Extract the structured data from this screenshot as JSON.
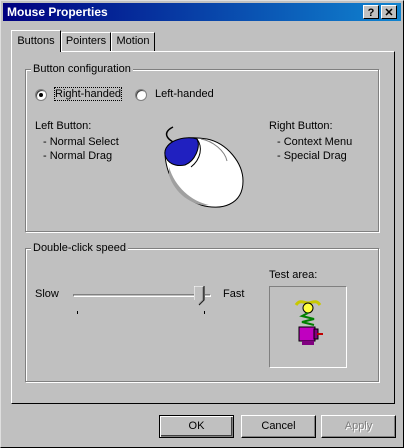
{
  "window": {
    "title": "Mouse Properties",
    "help_glyph": "?",
    "close_glyph": "✕"
  },
  "tabs": [
    {
      "label": "Buttons"
    },
    {
      "label": "Pointers"
    },
    {
      "label": "Motion"
    }
  ],
  "button_configuration": {
    "title": "Button configuration",
    "right_handed": "Right-handed",
    "left_handed": "Left-handed",
    "selected": "Right-handed",
    "left_button": {
      "title": "Left Button:",
      "items": [
        "-  Normal Select",
        "-  Normal Drag"
      ]
    },
    "right_button": {
      "title": "Right Button:",
      "items": [
        "-  Context Menu",
        "-  Special Drag"
      ]
    }
  },
  "double_click": {
    "title": "Double-click speed",
    "slow": "Slow",
    "fast": "Fast",
    "speed_level": 0.95,
    "test_area_label": "Test area:"
  },
  "buttons": {
    "ok": "OK",
    "cancel": "Cancel",
    "apply": "Apply"
  }
}
